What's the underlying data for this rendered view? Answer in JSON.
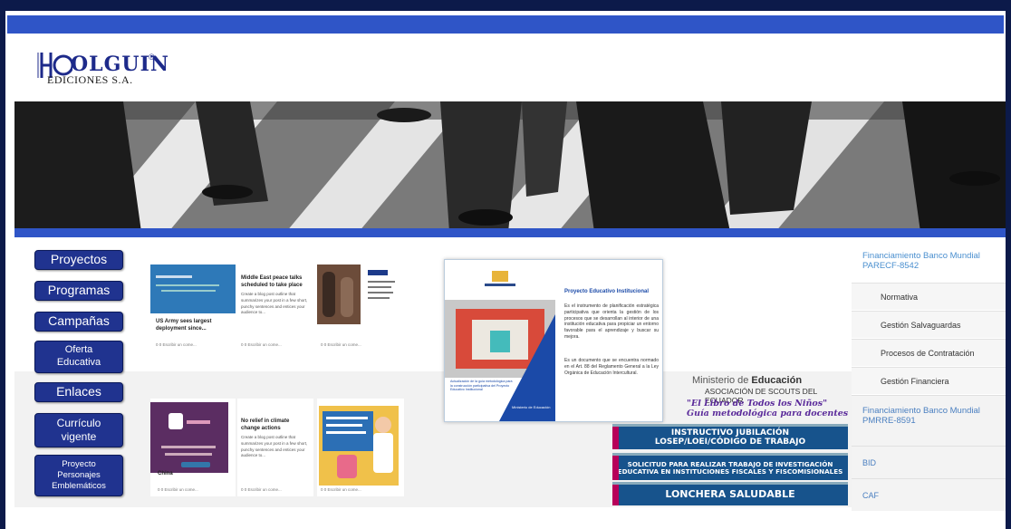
{
  "logo": {
    "brand": "OLGUIN",
    "sub": "EDICIONES S.A.",
    "reg": "®"
  },
  "nav": {
    "items": [
      {
        "label": "Proyectos"
      },
      {
        "label": "Programas"
      },
      {
        "label": "Campañas"
      },
      {
        "label": "Oferta Educativa"
      },
      {
        "label": "Enlaces"
      },
      {
        "label": "Currículo vigente"
      },
      {
        "label": "Proyecto Personajes Emblemáticos"
      }
    ]
  },
  "cards": {
    "c1": {
      "title": "US Army sees largest deployment since...",
      "foot": "0 0   Escribir un come..."
    },
    "c2": {
      "title": "Middle East peace talks scheduled to take place",
      "text": "Create a blog post outline that summarizes your post in a few short, punchy sentences and entices your audience to...",
      "foot": "0 0   Escribir un come..."
    },
    "c3": {
      "title": "",
      "foot": "0 0   Escribir un come..."
    },
    "c4": {
      "title": "China",
      "foot": "0 0   Escribir un come..."
    },
    "c5": {
      "title": "No relief in climate change actions",
      "text": "Create a blog post outline that summarizes your post in a few short, punchy sentences and entices your audience to...",
      "foot": "0 0   Escribir un come..."
    },
    "c6": {
      "title": "",
      "foot": "0 0   Escribir un come..."
    }
  },
  "feature": {
    "title": "Proyecto Educativo Institucional",
    "para1": "Es el instrumento de planificación estratégica participativa que orienta la gestión de los procesos que se desarrollan al interior de una institución educativa para propiciar un entorno favorable para el aprendizaje y buscar su mejora.",
    "para2": "Es un documento que se encuentra normado en el Art. 88 del Reglamento General a la Ley Orgánica de Educación Intercultural.",
    "img_caption": "Actualización de la guía metodológica para la construcción participativa del Proyecto Educativo Institucional",
    "ministry": "Ministerio de Educación"
  },
  "scouts": {
    "ministry_prefix": "Ministerio de ",
    "ministry_strong": "Educación",
    "assoc": "ASOCIACIÓN DE SCOUTS DEL ECUADOR",
    "book": "\"El Libro de Todos los Niños\"",
    "guide": "Guía metodológica para docentes"
  },
  "banners": [
    {
      "line1": "INSTRUCTIVO JUBILACIÓN",
      "line2": "LOSEP/LOEI/CÓDIGO DE TRABAJO"
    },
    {
      "line1": "SOLICITUD PARA REALIZAR TRABAJO DE INVESTIGACIÓN",
      "line2": "EDUCATIVA EN INSTITUCIONES FISCALES Y FISCOMISIONALES"
    },
    {
      "line1": "LONCHERA SALUDABLE",
      "line2": ""
    }
  ],
  "right": {
    "head1": "Financiamiento Banco Mundial PARECF-8542",
    "items": [
      "Normativa",
      "Gestión Salvaguardas",
      "Procesos de Contratación",
      "Gestión Financiera"
    ],
    "head2": "Financiamiento Banco Mundial PMRRE-8591",
    "bid": "BID",
    "caf": "CAF"
  },
  "colors": {
    "accent_blue": "#2f55c7",
    "nav_blue": "#20338f",
    "banner_blue": "#17538c",
    "banner_magenta": "#b7005a",
    "link_blue": "#4a8fcf"
  }
}
